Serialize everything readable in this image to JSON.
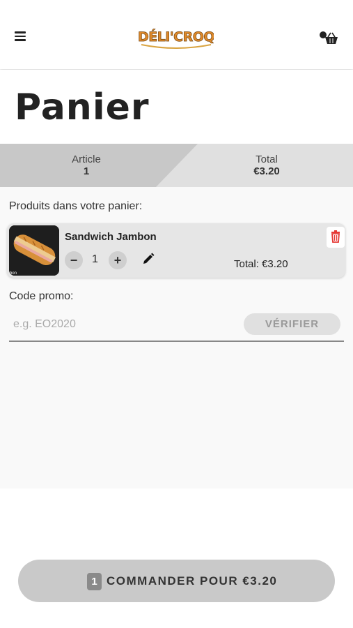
{
  "header": {
    "logo_text": "DÉLI'CROQ",
    "menu_icon": "hamburger-menu-icon",
    "cart_icon": "basket-icon"
  },
  "page": {
    "title": "Panier"
  },
  "summary": {
    "article_label": "Article",
    "article_value": "1",
    "total_label": "Total",
    "total_value": "€3.20"
  },
  "cart": {
    "section_label": "Produits dans votre panier:",
    "items": [
      {
        "name": "Sandwich Jambon",
        "quantity": "1",
        "decrement_label": "−",
        "increment_label": "+",
        "total_text": "Total: €3.20",
        "image_caption": "bon"
      }
    ]
  },
  "promo": {
    "label": "Code promo:",
    "placeholder": "e.g. EO2020",
    "value": "",
    "verify_label": "VÉRIFIER"
  },
  "order": {
    "count": "1",
    "label": "COMMANDER POUR €3.20"
  },
  "colors": {
    "delete": "#e53935",
    "summary_dark": "#c8c8c8",
    "summary_light": "#e0e0e0",
    "order_button": "#c9c9c9"
  }
}
